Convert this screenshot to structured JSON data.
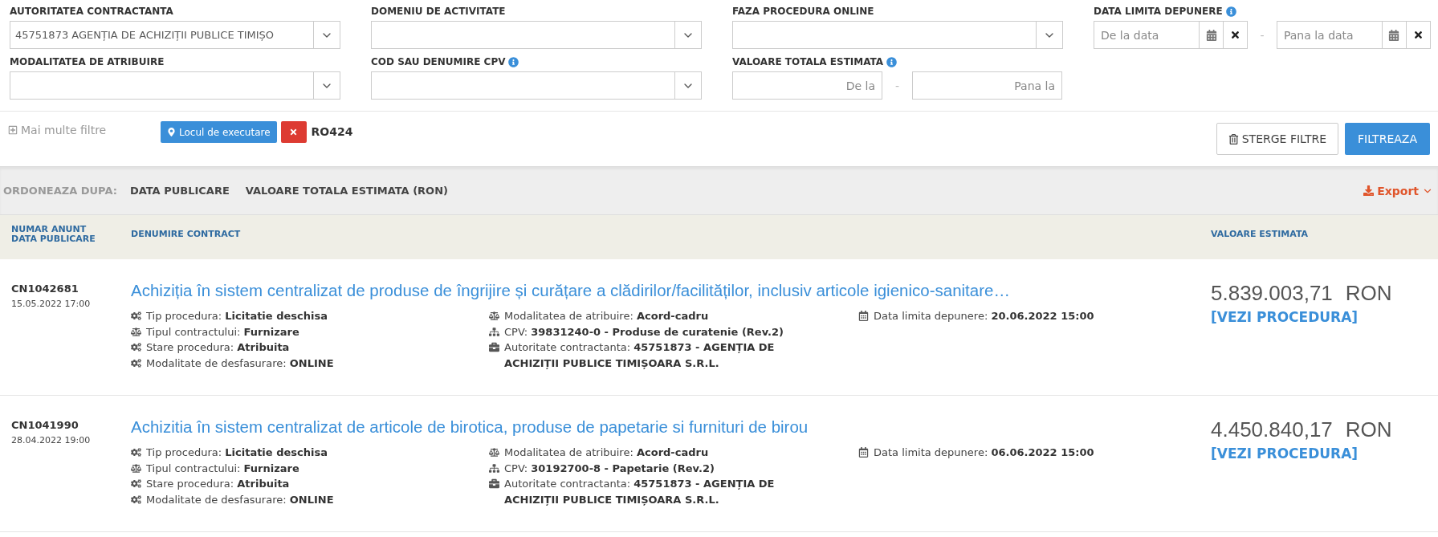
{
  "filters": [
    {
      "kind": "select",
      "label": "AUTORITATEA CONTRACTANTA",
      "info": false,
      "value": "45751873 AGENȚIA DE ACHIZIȚII PUBLICE TIMIȘO"
    },
    {
      "kind": "select",
      "label": "DOMENIU DE ACTIVITATE",
      "info": false
    },
    {
      "kind": "select",
      "label": "FAZA PROCEDURA ONLINE",
      "info": false
    },
    {
      "kind": "daterange",
      "label": "DATA LIMITA DEPUNERE",
      "info": true,
      "from": {
        "placeholder": "De la data"
      },
      "separator": "-",
      "to": {
        "placeholder": "Pana la data"
      }
    },
    {
      "kind": "select",
      "label": "MODALITATEA DE ATRIBUIRE",
      "info": false
    },
    {
      "kind": "select",
      "label": "COD SAU DENUMIRE CPV",
      "info": true
    },
    {
      "kind": "range",
      "label": "VALOARE TOTALA ESTIMATA",
      "info": true,
      "from": {
        "placeholder": "De la"
      },
      "separator": "-",
      "to": {
        "placeholder": "Pana la"
      }
    }
  ],
  "more_filters": "Mai multe filtre",
  "active_filter": {
    "label": "Locul de executare",
    "value": "RO424"
  },
  "buttons": {
    "clear": "STERGE FILTRE",
    "apply": "FILTREAZA"
  },
  "sort": {
    "label": "ORDONEAZA DUPA:",
    "options": [
      "DATA PUBLICARE",
      "VALOARE TOTALA ESTIMATA (RON)"
    ],
    "export": "Export"
  },
  "columns": {
    "number": [
      "NUMAR ANUNT",
      "DATA PUBLICARE"
    ],
    "name": "DENUMIRE CONTRACT",
    "value": "VALOARE ESTIMATA"
  },
  "rows": [
    {
      "number": "CN1042681",
      "date": "15.05.2022 17:00",
      "title": "Achiziția în sistem centralizat de produse de îngrijire și curățare a clădirilor/facilităților, inclusiv articole igienico-sanitare…",
      "amount": "5.839.003,71",
      "currency": "RON",
      "link": "[VEZI PROCEDURA]",
      "details": [
        [
          {
            "kind": "gears",
            "text": "Tip procedura: **Licitatie deschisa**"
          },
          {
            "kind": "scale",
            "text": "Tipul contractului: **Furnizare**"
          },
          {
            "kind": "gears",
            "text": "Stare procedura: **Atribuita**"
          },
          {
            "kind": "gears",
            "text": "Modalitate de desfasurare: **ONLINE**"
          }
        ],
        [
          {
            "kind": "scale",
            "text": "Modalitatea de atribuire: **Acord-cadru**"
          },
          {
            "kind": "sitemap",
            "text": "CPV: **39831240-0 - Produse de curatenie (Rev.2)**"
          },
          {
            "kind": "briefcase",
            "text": "Autoritate contractanta: **45751873 - AGENȚIA DE ACHIZIȚII PUBLICE TIMIȘOARA S.R.L.**"
          }
        ],
        [
          {
            "kind": "calendar",
            "text": "Data limita depunere: **20.06.2022 15:00**"
          }
        ]
      ]
    },
    {
      "number": "CN1041990",
      "date": "28.04.2022 19:00",
      "title": "Achizitia în sistem centralizat de articole de birotica, produse de papetarie si furnituri de birou",
      "amount": "4.450.840,17",
      "currency": "RON",
      "link": "[VEZI PROCEDURA]",
      "details": [
        [
          {
            "kind": "gears",
            "text": "Tip procedura: **Licitatie deschisa**"
          },
          {
            "kind": "scale",
            "text": "Tipul contractului: **Furnizare**"
          },
          {
            "kind": "gears",
            "text": "Stare procedura: **Atribuita**"
          },
          {
            "kind": "gears",
            "text": "Modalitate de desfasurare: **ONLINE**"
          }
        ],
        [
          {
            "kind": "scale",
            "text": "Modalitatea de atribuire: **Acord-cadru**"
          },
          {
            "kind": "sitemap",
            "text": "CPV: **30192700-8 - Papetarie (Rev.2)**"
          },
          {
            "kind": "briefcase",
            "text": "Autoritate contractanta: **45751873 - AGENȚIA DE ACHIZIȚII PUBLICE TIMIȘOARA S.R.L.**"
          }
        ],
        [
          {
            "kind": "calendar",
            "text": "Data limita depunere: **06.06.2022 15:00**"
          }
        ]
      ]
    }
  ]
}
